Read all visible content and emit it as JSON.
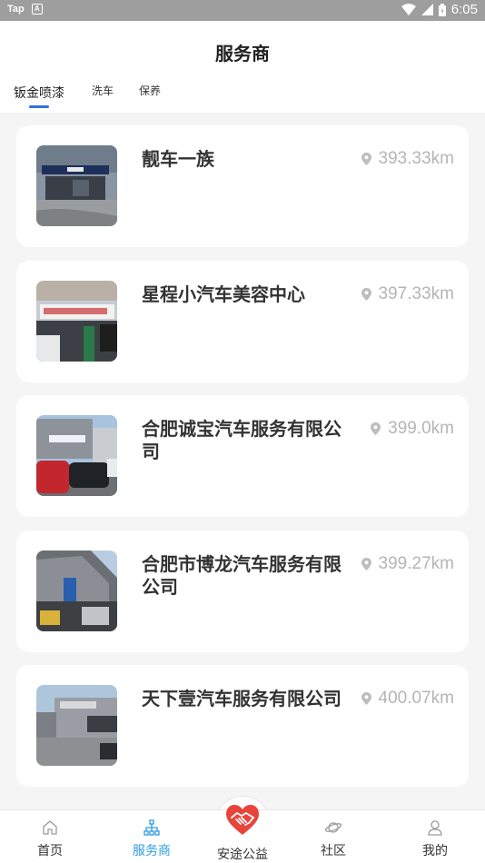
{
  "status_bar": {
    "app_icon_text": "Tap",
    "notif_icon_text": "A",
    "time": "6:05"
  },
  "header": {
    "title": "服务商"
  },
  "tabs": [
    {
      "label": "钣金喷漆",
      "active": true
    },
    {
      "label": "洗车",
      "active": false
    },
    {
      "label": "保养",
      "active": false
    }
  ],
  "providers": [
    {
      "name": "靓车一族",
      "distance": "393.33km"
    },
    {
      "name": "星程小汽车美容中心",
      "distance": "397.33km"
    },
    {
      "name": "合肥诚宝汽车服务有限公司",
      "distance": "399.0km"
    },
    {
      "name": "合肥市博龙汽车服务有限公司",
      "distance": "399.27km"
    },
    {
      "name": "天下壹汽车服务有限公司",
      "distance": "400.07km"
    }
  ],
  "bottom_nav": {
    "items": [
      {
        "label": "首页",
        "icon": "home-icon",
        "active": false
      },
      {
        "label": "服务商",
        "icon": "network-icon",
        "active": true
      },
      {
        "label": "社区",
        "icon": "planet-icon",
        "active": false
      },
      {
        "label": "我的",
        "icon": "user-icon",
        "active": false
      }
    ],
    "center": {
      "label": "安途公益",
      "icon": "handshake-heart-icon"
    }
  },
  "colors": {
    "accent": "#2f6fe4",
    "nav_active": "#2e9ce6",
    "heart": "#e8443c",
    "distance": "#b5b5b5"
  }
}
